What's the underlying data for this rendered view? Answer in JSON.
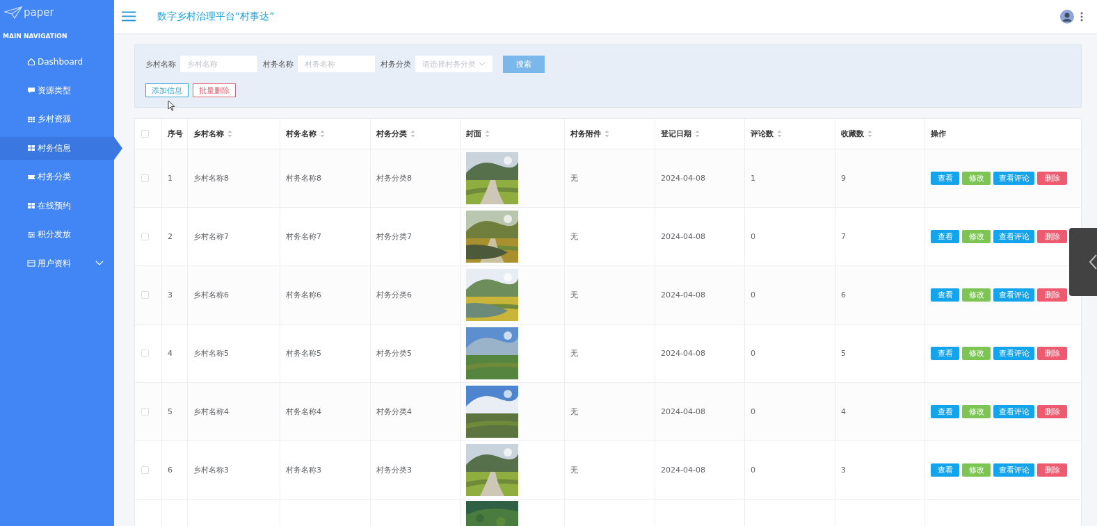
{
  "sidebar": {
    "logo": "paper",
    "section": "MAIN NAVIGATION",
    "items": [
      {
        "label": "Dashboard",
        "selected": false
      },
      {
        "label": "资源类型",
        "selected": false
      },
      {
        "label": "乡村资源",
        "selected": false
      },
      {
        "label": "村务信息",
        "selected": true
      },
      {
        "label": "村务分类",
        "selected": false
      },
      {
        "label": "在线预约",
        "selected": false
      },
      {
        "label": "积分发放",
        "selected": false
      },
      {
        "label": "用户资料",
        "selected": false,
        "expanded": false
      }
    ]
  },
  "header": {
    "title": "数字乡村治理平台“村事达”"
  },
  "search": {
    "fields": [
      {
        "label": "乡村名称",
        "placeholder": "乡村名称",
        "kind": "input"
      },
      {
        "label": "村务名称",
        "placeholder": "村务名称",
        "kind": "input"
      },
      {
        "label": "村务分类",
        "placeholder": "请选择村务分类",
        "kind": "select"
      }
    ],
    "button": "搜索",
    "actions": [
      {
        "label": "添加信息",
        "kind": "add"
      },
      {
        "label": "批量删除",
        "kind": "delete"
      }
    ]
  },
  "table": {
    "all_checked": false,
    "columns": [
      {
        "label": "序号",
        "sortable": false
      },
      {
        "label": "乡村名称",
        "sortable": true
      },
      {
        "label": "村务名称",
        "sortable": true
      },
      {
        "label": "村务分类",
        "sortable": true
      },
      {
        "label": "封面",
        "sortable": true
      },
      {
        "label": "村务附件",
        "sortable": true
      },
      {
        "label": "登记日期",
        "sortable": true
      },
      {
        "label": "评论数",
        "sortable": true
      },
      {
        "label": "收藏数",
        "sortable": true
      },
      {
        "label": "操作",
        "sortable": false
      }
    ],
    "rows": [
      {
        "checked": false,
        "cells": [
          "1",
          "乡村名称8",
          "村务名称8",
          "村务分类8",
          {
            "kind": "picture"
          },
          "无",
          "2024-04-08",
          "1",
          "9"
        ],
        "actions": [
          {
            "label": "查看",
            "kind": "view"
          },
          {
            "label": "修改",
            "kind": "edit"
          },
          {
            "label": "查看评论",
            "kind": "comments"
          },
          {
            "label": "删除",
            "kind": "delete"
          }
        ]
      },
      {
        "checked": false,
        "cells": [
          "2",
          "乡村名称7",
          "村务名称7",
          "村务分类7",
          {
            "kind": "picture"
          },
          "无",
          "2024-04-08",
          "0",
          "7"
        ],
        "actions": [
          {
            "label": "查看",
            "kind": "view"
          },
          {
            "label": "修改",
            "kind": "edit"
          },
          {
            "label": "查看评论",
            "kind": "comments"
          },
          {
            "label": "删除",
            "kind": "delete"
          }
        ]
      },
      {
        "checked": false,
        "cells": [
          "3",
          "乡村名称6",
          "村务名称6",
          "村务分类6",
          {
            "kind": "picture"
          },
          "无",
          "2024-04-08",
          "0",
          "6"
        ],
        "actions": [
          {
            "label": "查看",
            "kind": "view"
          },
          {
            "label": "修改",
            "kind": "edit"
          },
          {
            "label": "查看评论",
            "kind": "comments"
          },
          {
            "label": "删除",
            "kind": "delete"
          }
        ]
      },
      {
        "checked": false,
        "cells": [
          "4",
          "乡村名称5",
          "村务名称5",
          "村务分类5",
          {
            "kind": "picture"
          },
          "无",
          "2024-04-08",
          "0",
          "5"
        ],
        "actions": [
          {
            "label": "查看",
            "kind": "view"
          },
          {
            "label": "修改",
            "kind": "edit"
          },
          {
            "label": "查看评论",
            "kind": "comments"
          },
          {
            "label": "删除",
            "kind": "delete"
          }
        ]
      },
      {
        "checked": false,
        "cells": [
          "5",
          "乡村名称4",
          "村务名称4",
          "村务分类4",
          {
            "kind": "picture"
          },
          "无",
          "2024-04-08",
          "0",
          "4"
        ],
        "actions": [
          {
            "label": "查看",
            "kind": "view"
          },
          {
            "label": "修改",
            "kind": "edit"
          },
          {
            "label": "查看评论",
            "kind": "comments"
          },
          {
            "label": "删除",
            "kind": "delete"
          }
        ]
      },
      {
        "checked": false,
        "cells": [
          "6",
          "乡村名称3",
          "村务名称3",
          "村务分类3",
          {
            "kind": "picture"
          },
          "无",
          "2024-04-08",
          "0",
          "3"
        ],
        "actions": [
          {
            "label": "查看",
            "kind": "view"
          },
          {
            "label": "修改",
            "kind": "edit"
          },
          {
            "label": "查看评论",
            "kind": "comments"
          },
          {
            "label": "删除",
            "kind": "delete"
          }
        ]
      }
    ]
  }
}
